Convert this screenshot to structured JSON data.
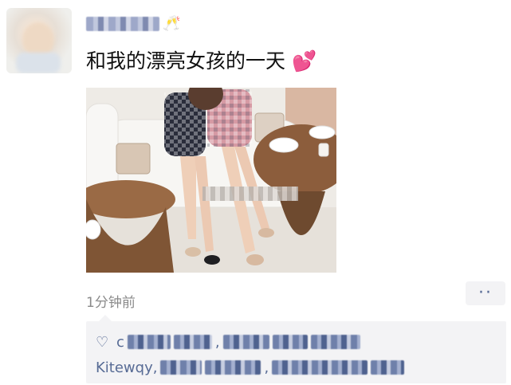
{
  "post": {
    "text": "和我的漂亮女孩的一天",
    "emoji": "💕",
    "username_emoji": "🥂",
    "timestamp": "1分钟前",
    "more_icon": "··"
  },
  "likes": {
    "heart_icon": "♡",
    "line1_start": "c",
    "line1_sep": ",",
    "line2_start": "Kitewqy,",
    "line2_sep": ","
  },
  "colors": {
    "link": "#576b95",
    "timestamp": "#8a8a8a",
    "panel": "#f3f3f5"
  }
}
